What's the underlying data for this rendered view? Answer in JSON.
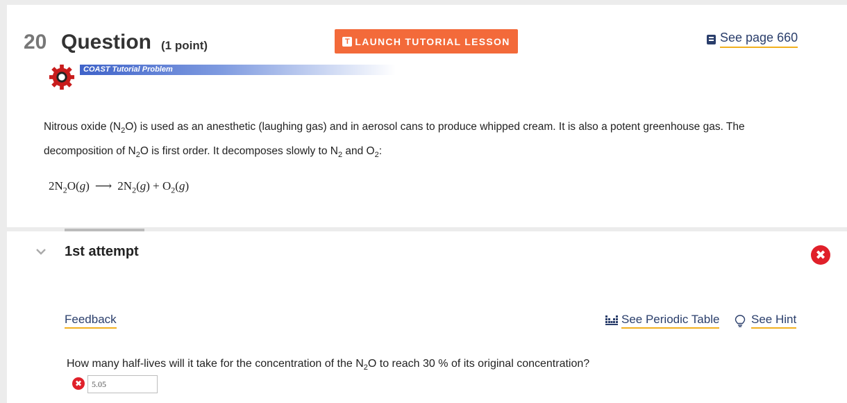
{
  "question": {
    "number": "20",
    "label": "Question",
    "points": "(1 point)"
  },
  "toolbar": {
    "tutorial_icon": "T",
    "tutorial_label": "LAUNCH TUTORIAL LESSON",
    "see_page_label": "See page 660"
  },
  "banner": {
    "label": "COAST Tutorial Problem"
  },
  "problem": {
    "p1": "Nitrous oxide (N",
    "s1": "2",
    "p2": "O) is used as an anesthetic (laughing gas) and in aerosol cans to produce whipped cream. It is also a potent greenhouse gas. The decomposition of N",
    "s2": "2",
    "p3": "O is first order. It decomposes slowly to N",
    "s3": "2",
    "p4": " and O",
    "s4": "2",
    "p5": ":"
  },
  "equation": {
    "r1": "2N",
    "r1s": "2",
    "r2": "O(",
    "r2g": "g",
    "r2c": ")",
    "arrow": "⟶",
    "p1": "2N",
    "p1s": "2",
    "p1o": "(",
    "p1g": "g",
    "p1c": ")",
    "plus": " + ",
    "p2": "O",
    "p2s": "2",
    "p2o": "(",
    "p2g": "g",
    "p2c": ")"
  },
  "attempt": {
    "title": "1st attempt",
    "status_glyph": "✖"
  },
  "links": {
    "feedback": "Feedback",
    "periodic_table": "See Periodic Table",
    "hint": "See Hint"
  },
  "prompt": {
    "t1": "How many half-lives will it take for the concentration of the N",
    "s1": "2",
    "t2": "O to reach 30 % of its original concentration?"
  },
  "answer": {
    "value": "5.05",
    "status_glyph": "✖"
  },
  "colors": {
    "accent_orange": "#f36a3a",
    "link_blue": "#2a3e6b",
    "underline_gold": "#f2b01e",
    "error_red": "#e0202a",
    "banner_blue": "#3f63c9"
  }
}
